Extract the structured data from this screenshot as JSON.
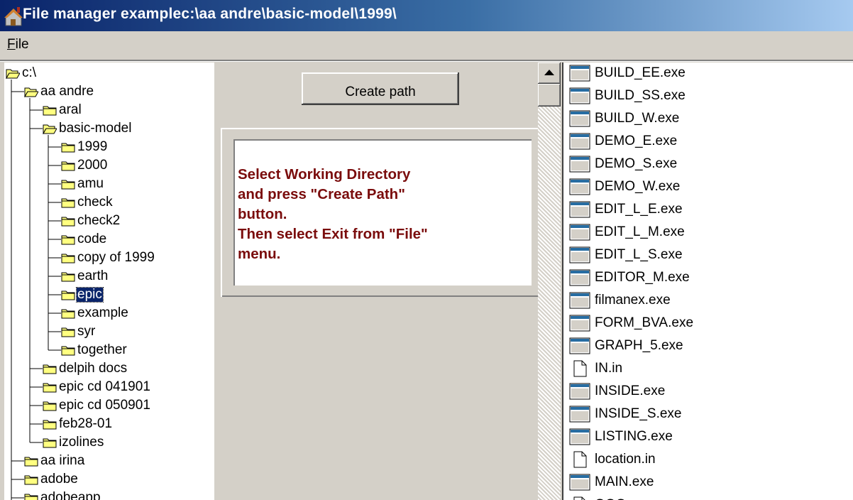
{
  "window": {
    "title": "File manager examplec:\\aa andre\\basic-model\\1999\\"
  },
  "menu": {
    "file": "File"
  },
  "tree": {
    "items": [
      {
        "label": "c:\\",
        "level": 0,
        "icon": "open-folder-icon"
      },
      {
        "label": "aa andre",
        "level": 1,
        "icon": "open-folder-icon"
      },
      {
        "label": "aral",
        "level": 2,
        "icon": "folder-icon"
      },
      {
        "label": "basic-model",
        "level": 2,
        "icon": "open-folder-icon"
      },
      {
        "label": "1999",
        "level": 3,
        "icon": "folder-icon"
      },
      {
        "label": "2000",
        "level": 3,
        "icon": "folder-icon"
      },
      {
        "label": "amu",
        "level": 3,
        "icon": "folder-icon"
      },
      {
        "label": "check",
        "level": 3,
        "icon": "folder-icon"
      },
      {
        "label": "check2",
        "level": 3,
        "icon": "folder-icon"
      },
      {
        "label": "code",
        "level": 3,
        "icon": "folder-icon"
      },
      {
        "label": "copy of 1999",
        "level": 3,
        "icon": "folder-icon"
      },
      {
        "label": "earth",
        "level": 3,
        "icon": "folder-icon"
      },
      {
        "label": "epic",
        "level": 3,
        "icon": "folder-icon",
        "selected": true
      },
      {
        "label": "example",
        "level": 3,
        "icon": "folder-icon"
      },
      {
        "label": "syr",
        "level": 3,
        "icon": "folder-icon"
      },
      {
        "label": "together",
        "level": 3,
        "icon": "folder-icon"
      },
      {
        "label": "delpih docs",
        "level": 2,
        "icon": "folder-icon"
      },
      {
        "label": "epic cd 041901",
        "level": 2,
        "icon": "folder-icon"
      },
      {
        "label": "epic cd 050901",
        "level": 2,
        "icon": "folder-icon"
      },
      {
        "label": "feb28-01",
        "level": 2,
        "icon": "folder-icon"
      },
      {
        "label": "izolines",
        "level": 2,
        "icon": "folder-icon"
      },
      {
        "label": "aa irina",
        "level": 1,
        "icon": "folder-icon"
      },
      {
        "label": "adobe",
        "level": 1,
        "icon": "folder-icon"
      },
      {
        "label": "adobeapp",
        "level": 1,
        "icon": "folder-icon"
      }
    ]
  },
  "buttons": {
    "create_path": "Create path"
  },
  "info": {
    "message": "Select Working Directory\nand press \"Create Path\"\nbutton.\nThen select Exit from \"File\"\nmenu."
  },
  "colors": {
    "title_start": "#0a246a",
    "title_end": "#a6caf0",
    "info_text": "#7a0c0c",
    "selection": "#0a246a"
  },
  "files": [
    {
      "name": "BUILD_EE.exe",
      "type": "exe"
    },
    {
      "name": "BUILD_SS.exe",
      "type": "exe"
    },
    {
      "name": "BUILD_W.exe",
      "type": "exe"
    },
    {
      "name": "DEMO_E.exe",
      "type": "exe"
    },
    {
      "name": "DEMO_S.exe",
      "type": "exe"
    },
    {
      "name": "DEMO_W.exe",
      "type": "exe"
    },
    {
      "name": "EDIT_L_E.exe",
      "type": "exe"
    },
    {
      "name": "EDIT_L_M.exe",
      "type": "exe"
    },
    {
      "name": "EDIT_L_S.exe",
      "type": "exe"
    },
    {
      "name": "EDITOR_M.exe",
      "type": "exe"
    },
    {
      "name": "filmanex.exe",
      "type": "exe"
    },
    {
      "name": "FORM_BVA.exe",
      "type": "exe"
    },
    {
      "name": "GRAPH_5.exe",
      "type": "exe"
    },
    {
      "name": "IN.in",
      "type": "doc"
    },
    {
      "name": "INSIDE.exe",
      "type": "exe"
    },
    {
      "name": "INSIDE_S.exe",
      "type": "exe"
    },
    {
      "name": "LISTING.exe",
      "type": "exe"
    },
    {
      "name": "location.in",
      "type": "doc"
    },
    {
      "name": "MAIN.exe",
      "type": "exe"
    },
    {
      "name": "OOO...",
      "type": "doc"
    }
  ]
}
